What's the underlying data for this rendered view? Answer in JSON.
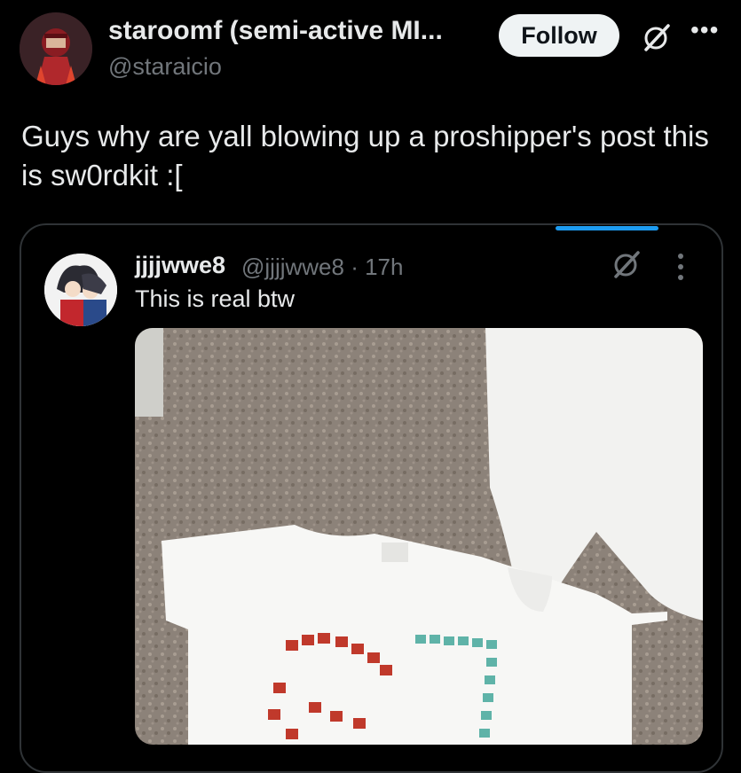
{
  "author": {
    "display_name": "staroomf (semi-active MI...",
    "handle": "@staraicio"
  },
  "actions": {
    "follow_label": "Follow",
    "grok_icon": "grok-slash-icon",
    "more_icon": "more-horizontal-icon"
  },
  "post": {
    "text": "Guys why are yall blowing up a proshipper's post this is sw0rdkit :["
  },
  "quoted": {
    "name": "jjjjwwe8",
    "handle_time": "@jjjjwwe8 · 17h",
    "text": "This is real btw",
    "grok_icon": "grok-slash-icon",
    "more_icon": "more-vertical-icon"
  },
  "colors": {
    "background": "#000000",
    "accent": "#1d9bf0",
    "follow_bg": "#eff3f4",
    "secondary_text": "#71767b"
  }
}
